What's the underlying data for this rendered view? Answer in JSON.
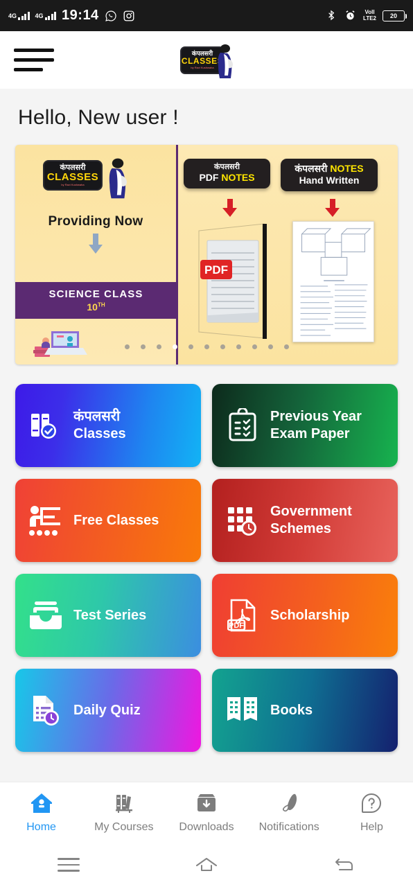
{
  "statusbar": {
    "network_1": "4G",
    "network_2": "4G",
    "time": "19:14",
    "app_icon_1": "whatsapp-icon",
    "app_icon_2": "instagram-icon",
    "bluetooth_icon": "bluetooth-icon",
    "alarm_icon": "alarm-clock-icon",
    "volte_line1": "VoII",
    "volte_line2": "LTE2",
    "battery_level": "20"
  },
  "header": {
    "menu_icon": "hamburger-menu-icon",
    "logo": {
      "hindi_text": "कंपलसरी",
      "english_text": "CLASSES",
      "tagline": "by Ravi Kushwaha"
    }
  },
  "greeting": "Hello, New user !",
  "banner": {
    "left_slide": {
      "logo_hindi": "कंपलसरी",
      "logo_english": "CLASSES",
      "heading": "Providing Now",
      "band_line1": "SCIENCE CLASS",
      "band_line2": "10",
      "band_line2_sup": "TH"
    },
    "pdf_badge": {
      "line1": "कंपलसरी",
      "line2_white": "PDF",
      "line2_yellow": "NOTES"
    },
    "handwritten_badge": {
      "line1_white": "कंपलसरी",
      "line1_yellow": "NOTES",
      "line2": "Hand Written"
    },
    "pdf_label": "PDF",
    "dots_total": 11,
    "dots_active_index": 3
  },
  "cards": [
    {
      "id": "compulsory-classes",
      "hindi": "कंपलसरी",
      "english": "Classes",
      "icon": "books-check-icon",
      "gradient": "linear-gradient(100deg,#3d1ae8 0%,#3c2ee9 25%,#1e86f0 70%,#12b3f5 100%)"
    },
    {
      "id": "previous-year-exam-paper",
      "hindi": "",
      "english": "Previous Year Exam Paper",
      "icon": "clipboard-checklist-icon",
      "gradient": "linear-gradient(100deg,#0d2a1c 0%,#14633a 45%,#17b34f 100%)"
    },
    {
      "id": "free-classes",
      "hindi": "",
      "english": "Free Classes",
      "icon": "presentation-teacher-icon",
      "gradient": "linear-gradient(100deg,#ef4136 0%,#f4601e 55%,#f97a09 100%)"
    },
    {
      "id": "government-schemes",
      "hindi": "",
      "english": "Government Schemes",
      "icon": "calendar-clock-icon",
      "gradient": "linear-gradient(100deg,#b3201f 0%,#d23c37 50%,#e8635c 100%)"
    },
    {
      "id": "test-series",
      "hindi": "",
      "english": "Test Series",
      "icon": "inbox-tray-icon",
      "gradient": "linear-gradient(100deg,#33e08a 0%,#2ec8a9 45%,#3b8ee0 100%)"
    },
    {
      "id": "scholarship",
      "hindi": "",
      "english": "Scholarship",
      "icon": "pdf-file-icon",
      "gradient": "linear-gradient(100deg,#ef3e33 0%,#f4601e 55%,#fa800a 100%)"
    },
    {
      "id": "daily-quiz",
      "hindi": "",
      "english": "Daily Quiz",
      "icon": "document-timer-icon",
      "gradient": "linear-gradient(100deg,#17c8e8 0%,#6a6ae8 50%,#ef17e0 100%)"
    },
    {
      "id": "books",
      "hindi": "",
      "english": "Books",
      "icon": "open-book-icon",
      "gradient": "linear-gradient(100deg,#13a38f 0%,#0f6f92 50%,#14206e 100%)"
    }
  ],
  "bottom_nav": {
    "active": "Home",
    "items": [
      {
        "label": "Home",
        "icon": "home-icon"
      },
      {
        "label": "My Courses",
        "icon": "bookshelf-icon"
      },
      {
        "label": "Downloads",
        "icon": "download-box-icon"
      },
      {
        "label": "Notifications",
        "icon": "bell-icon"
      },
      {
        "label": "Help",
        "icon": "question-mark-icon"
      }
    ]
  },
  "system_nav": {
    "recents": "recents-icon",
    "home": "home-outline-icon",
    "back": "back-arrow-icon"
  },
  "colors": {
    "accent": "#2196f3",
    "banner_bg": "#fbe3a0",
    "band_purple": "#5b2a72",
    "badge_black": "#231f20",
    "badge_yellow": "#ffe600"
  }
}
